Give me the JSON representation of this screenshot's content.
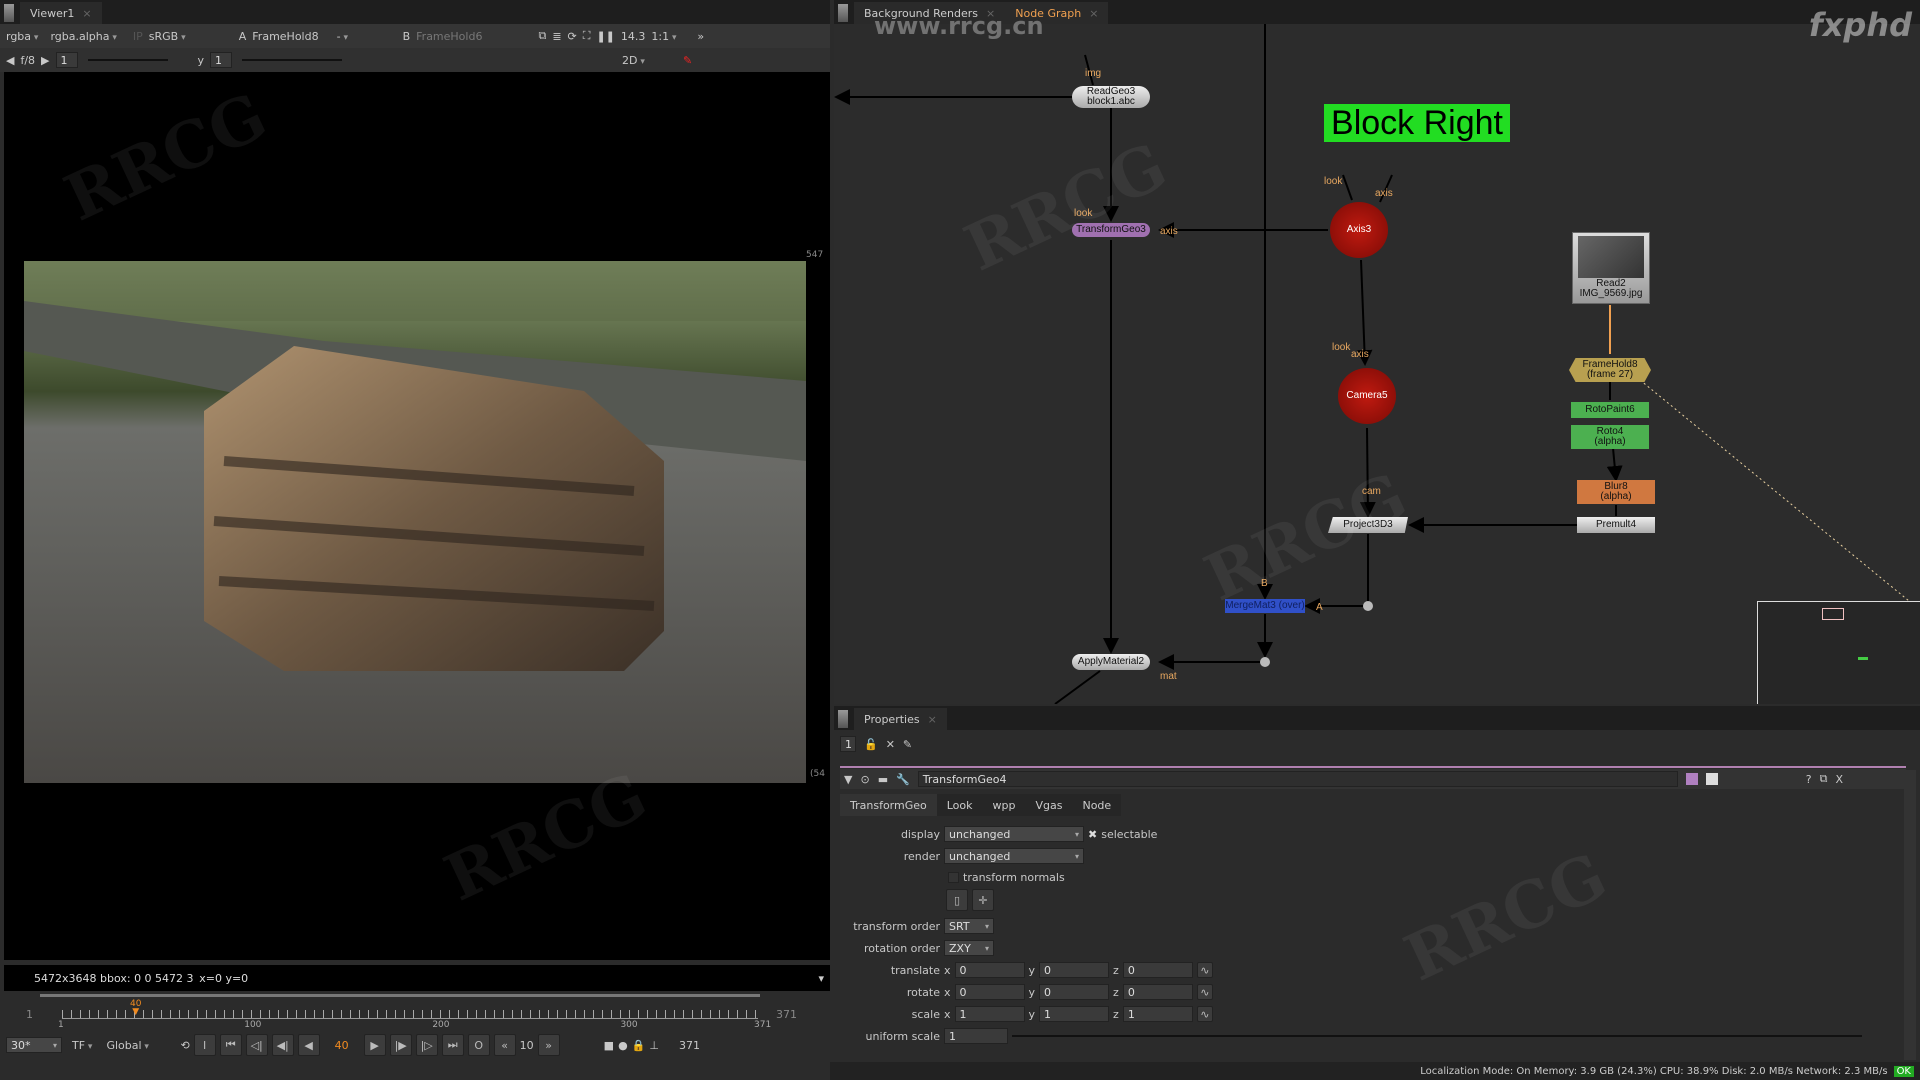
{
  "viewer": {
    "tab": "Viewer1",
    "channels": "rgba",
    "alpha": "rgba.alpha",
    "ip": "IP",
    "colorspace": "sRGB",
    "a_label": "A",
    "a_input": "FrameHold8",
    "op": "-",
    "b_label": "B",
    "b_input": "FrameHold6",
    "fstop": "14.3",
    "zoom": "1:1",
    "gain_label": "f/8",
    "gain": "1",
    "gamma_label": "y",
    "gamma": "1",
    "view_mode": "2D",
    "edge_top": "547",
    "edge_right": "(54",
    "info": "5472x3648  bbox: 0 0 5472 3  x=0 y=0"
  },
  "timeline": {
    "start": "1",
    "end": "371",
    "current": "40",
    "ticks": [
      "1",
      "100",
      "200",
      "300",
      "371"
    ],
    "current_fraction": 0.106,
    "fps": "30*",
    "tf": "TF",
    "scope": "Global",
    "in": "I",
    "out": "O",
    "step": "10",
    "end_field": "371"
  },
  "nodegraph": {
    "tabs": [
      {
        "label": "Background Renders"
      },
      {
        "label": "Node Graph",
        "active": true
      }
    ],
    "backdrop": "Block Right",
    "backdrop_color": "#22dd22",
    "nodes": {
      "readgeo": [
        "ReadGeo3",
        "block1.abc"
      ],
      "transformgeo": "TransformGeo3",
      "axis": "Axis3",
      "camera": "Camera5",
      "read": [
        "Read2",
        "IMG_9569.jpg"
      ],
      "framehold": [
        "FrameHold8",
        "(frame 27)"
      ],
      "rotopaint": "RotoPaint6",
      "roto": [
        "Roto4",
        "(alpha)"
      ],
      "blur": [
        "Blur8",
        "(alpha)"
      ],
      "premult": "Premult4",
      "project": "Project3D3",
      "mergemat": "MergeMat3 (over)",
      "applymat": "ApplyMaterial2"
    },
    "pins": {
      "img": "img",
      "look": "look",
      "axis": "axis",
      "cam": "cam",
      "b": "B",
      "a": "A",
      "mat": "mat"
    }
  },
  "properties": {
    "tab": "Properties",
    "max_panels": "1",
    "node_name": "TransformGeo4",
    "tabs": [
      "TransformGeo",
      "Look",
      "wpp",
      "Vgas",
      "Node"
    ],
    "display_label": "display",
    "display": "unchanged",
    "selectable": "selectable",
    "render_label": "render",
    "render": "unchanged",
    "transform_normals": "transform normals",
    "transform_order_label": "transform order",
    "transform_order": "SRT",
    "rotation_order_label": "rotation order",
    "rotation_order": "ZXY",
    "translate": {
      "label": "translate",
      "x": "0",
      "y": "0",
      "z": "0"
    },
    "rotate": {
      "label": "rotate",
      "x": "0",
      "y": "0",
      "z": "0"
    },
    "scale": {
      "label": "scale",
      "x": "1",
      "y": "1",
      "z": "1"
    },
    "uniform_scale": {
      "label": "uniform scale",
      "value": "1"
    }
  },
  "status": "Localization Mode: On Memory: 3.9 GB (24.3%) CPU: 38.9% Disk: 2.0 MB/s Network: 2.3 MB/s",
  "status_ok": "OK",
  "watermark": {
    "url": "www.rrcg.cn",
    "brand": "fxphd"
  }
}
